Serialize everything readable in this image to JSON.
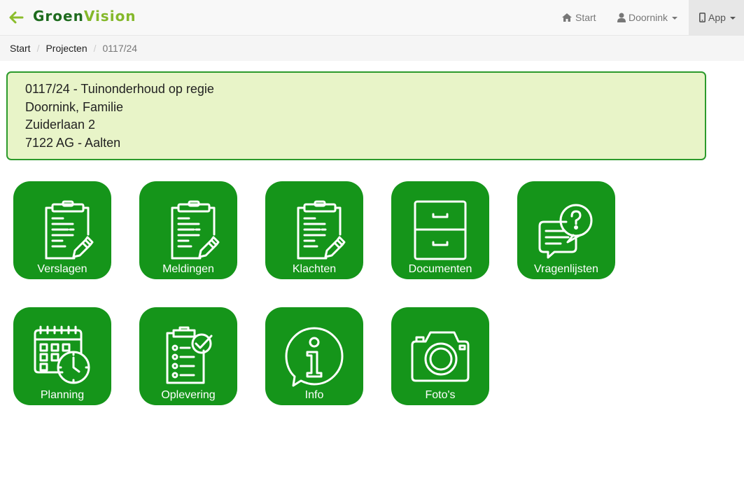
{
  "header": {
    "brand_part1": "Groen",
    "brand_part2": "Vision",
    "nav": [
      {
        "label": "Start",
        "icon": "home-icon"
      },
      {
        "label": "Doornink",
        "icon": "user-icon"
      },
      {
        "label": "App",
        "icon": "mobile-icon"
      }
    ]
  },
  "breadcrumb": {
    "items": [
      "Start",
      "Projecten"
    ],
    "active": "0117/24"
  },
  "project": {
    "line1": "0117/24 - Tuinonderhoud op regie",
    "line2": "Doornink, Familie",
    "line3": "Zuiderlaan 2",
    "line4": "7122 AG - Aalten"
  },
  "tiles": [
    {
      "label": "Verslagen",
      "icon": "clipboard-pencil-icon"
    },
    {
      "label": "Meldingen",
      "icon": "clipboard-pencil-icon"
    },
    {
      "label": "Klachten",
      "icon": "clipboard-pencil-icon"
    },
    {
      "label": "Documenten",
      "icon": "filing-cabinet-icon"
    },
    {
      "label": "Vragenlijsten",
      "icon": "speech-bubbles-question-icon"
    },
    {
      "label": "Planning",
      "icon": "calendar-clock-icon"
    },
    {
      "label": "Oplevering",
      "icon": "clipboard-check-icon"
    },
    {
      "label": "Info",
      "icon": "info-bubble-icon"
    },
    {
      "label": "Foto's",
      "icon": "camera-icon"
    }
  ],
  "colors": {
    "tile_green": "#15951a",
    "info_bg": "#e8f4c8",
    "info_border": "#2c9a2c"
  }
}
